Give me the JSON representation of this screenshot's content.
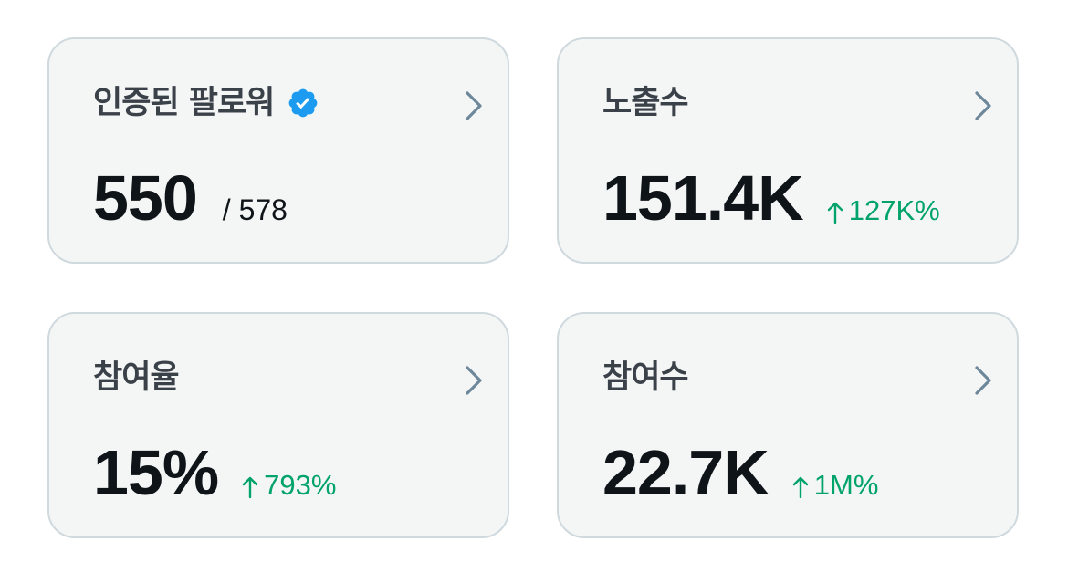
{
  "colors": {
    "card_background": "#f4f6f6",
    "card_border": "#cfd9de",
    "title_text": "#3b4149",
    "value_text": "#0f1419",
    "positive_change": "#00a36a",
    "verified_badge": "#1d9bf0",
    "chevron": "#6d879b"
  },
  "cards": [
    {
      "title": "인증된 팔로워",
      "title_icon": "verified-badge-icon",
      "value": "550",
      "secondary": "/ 578",
      "action_icon": "chevron-right-icon"
    },
    {
      "title": "노출수",
      "value": "151.4K",
      "change": "127K%",
      "change_icon": "arrow-up-icon",
      "action_icon": "chevron-right-icon"
    },
    {
      "title": "참여율",
      "value": "15%",
      "change": "793%",
      "change_icon": "arrow-up-icon",
      "action_icon": "chevron-right-icon"
    },
    {
      "title": "참여수",
      "value": "22.7K",
      "change": "1M%",
      "change_icon": "arrow-up-icon",
      "action_icon": "chevron-right-icon"
    }
  ]
}
